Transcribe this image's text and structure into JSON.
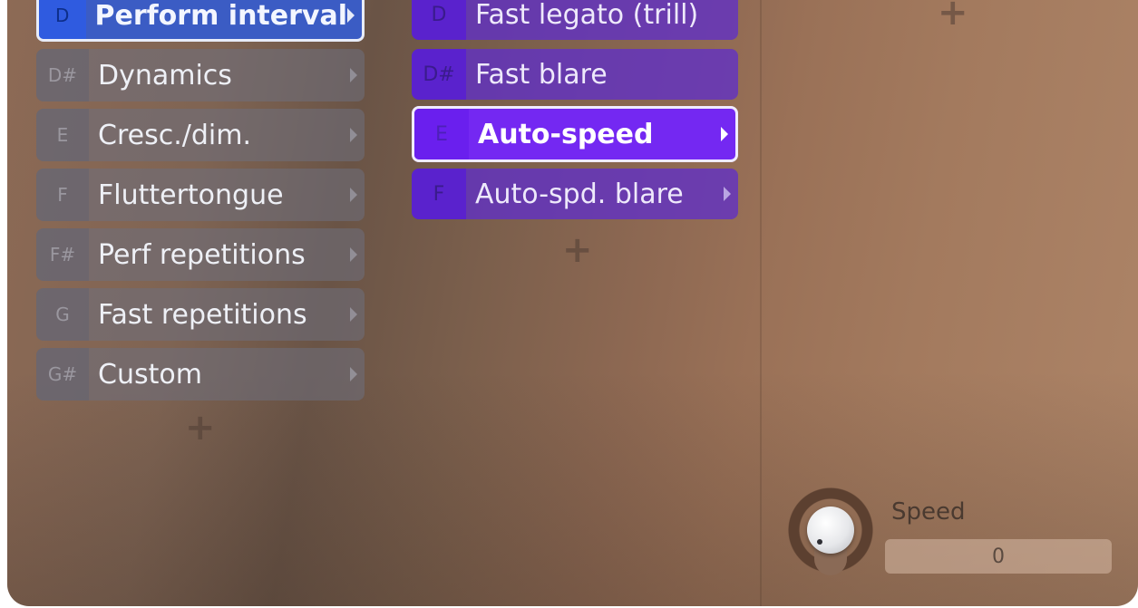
{
  "column1": {
    "items": [
      {
        "key": "D",
        "label": "Perform interval",
        "active": true
      },
      {
        "key": "D#",
        "label": "Dynamics"
      },
      {
        "key": "E",
        "label": "Cresc./dim."
      },
      {
        "key": "F",
        "label": "Fluttertongue"
      },
      {
        "key": "F#",
        "label": "Perf repetitions"
      },
      {
        "key": "G",
        "label": "Fast repetitions"
      },
      {
        "key": "G#",
        "label": "Custom"
      }
    ],
    "add_label": "+"
  },
  "column2": {
    "items": [
      {
        "key": "D",
        "label": "Fast legato (trill)"
      },
      {
        "key": "D#",
        "label": "Fast blare"
      },
      {
        "key": "E",
        "label": "Auto-speed",
        "active": true
      },
      {
        "key": "F",
        "label": "Auto-spd. blare"
      }
    ],
    "add_label": "+"
  },
  "column3": {
    "add_label": "+"
  },
  "knob": {
    "label": "Speed",
    "value": "0"
  },
  "colors": {
    "col1_active": "#3b5cc4",
    "col1_item": "#6e707d",
    "col2_item": "#6030c8",
    "col2_active": "#7428f2"
  }
}
